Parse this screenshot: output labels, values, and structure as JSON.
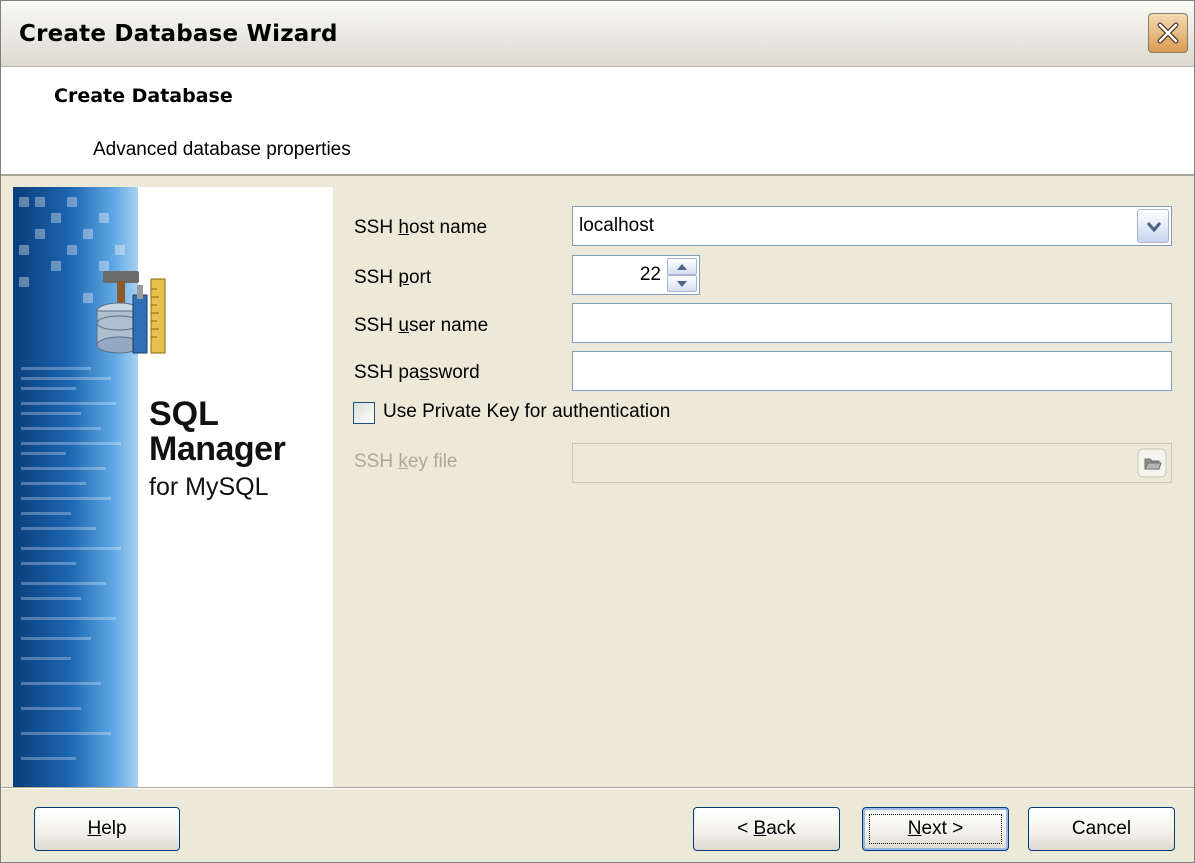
{
  "window": {
    "title": "Create Database Wizard"
  },
  "header": {
    "title": "Create Database",
    "subtitle": "Advanced database properties"
  },
  "banner": {
    "product_line1": "SQL",
    "product_line2": "Manager",
    "product_line3": "for MySQL"
  },
  "form": {
    "host_label": {
      "pre": "SSH ",
      "key": "h",
      "post": "ost name"
    },
    "host_value": "localhost",
    "port_label": {
      "pre": "SSH ",
      "key": "p",
      "post": "ort"
    },
    "port_value": "22",
    "user_label": {
      "pre": "SSH ",
      "key": "u",
      "post": "ser name"
    },
    "user_value": "",
    "password_label": {
      "pre": "SSH pa",
      "key": "s",
      "post": "sword"
    },
    "password_value": "",
    "private_key_label": "Use Private Key for authentication",
    "private_key_checked": false,
    "keyfile_label": {
      "pre": "SSH ",
      "key": "k",
      "post": "ey file"
    },
    "keyfile_value": ""
  },
  "buttons": {
    "help": {
      "key": "H",
      "rest": "elp"
    },
    "back": {
      "pre": "< ",
      "key": "B",
      "rest": "ack"
    },
    "next": {
      "key": "N",
      "rest": "ext >"
    },
    "cancel": "Cancel"
  },
  "colors": {
    "titlebar": "#ecebe5",
    "dialog_bg": "#ece9d8",
    "field_border": "#7f9db9",
    "close_button": "#e9b97c",
    "banner_blue": "#1c65b0"
  },
  "icons": {
    "close": "close-x-icon",
    "dropdown": "chevron-down-icon",
    "spin_up": "arrow-up-icon",
    "spin_down": "arrow-down-icon",
    "browse": "folder-open-icon",
    "app": "database-tools-icon"
  }
}
